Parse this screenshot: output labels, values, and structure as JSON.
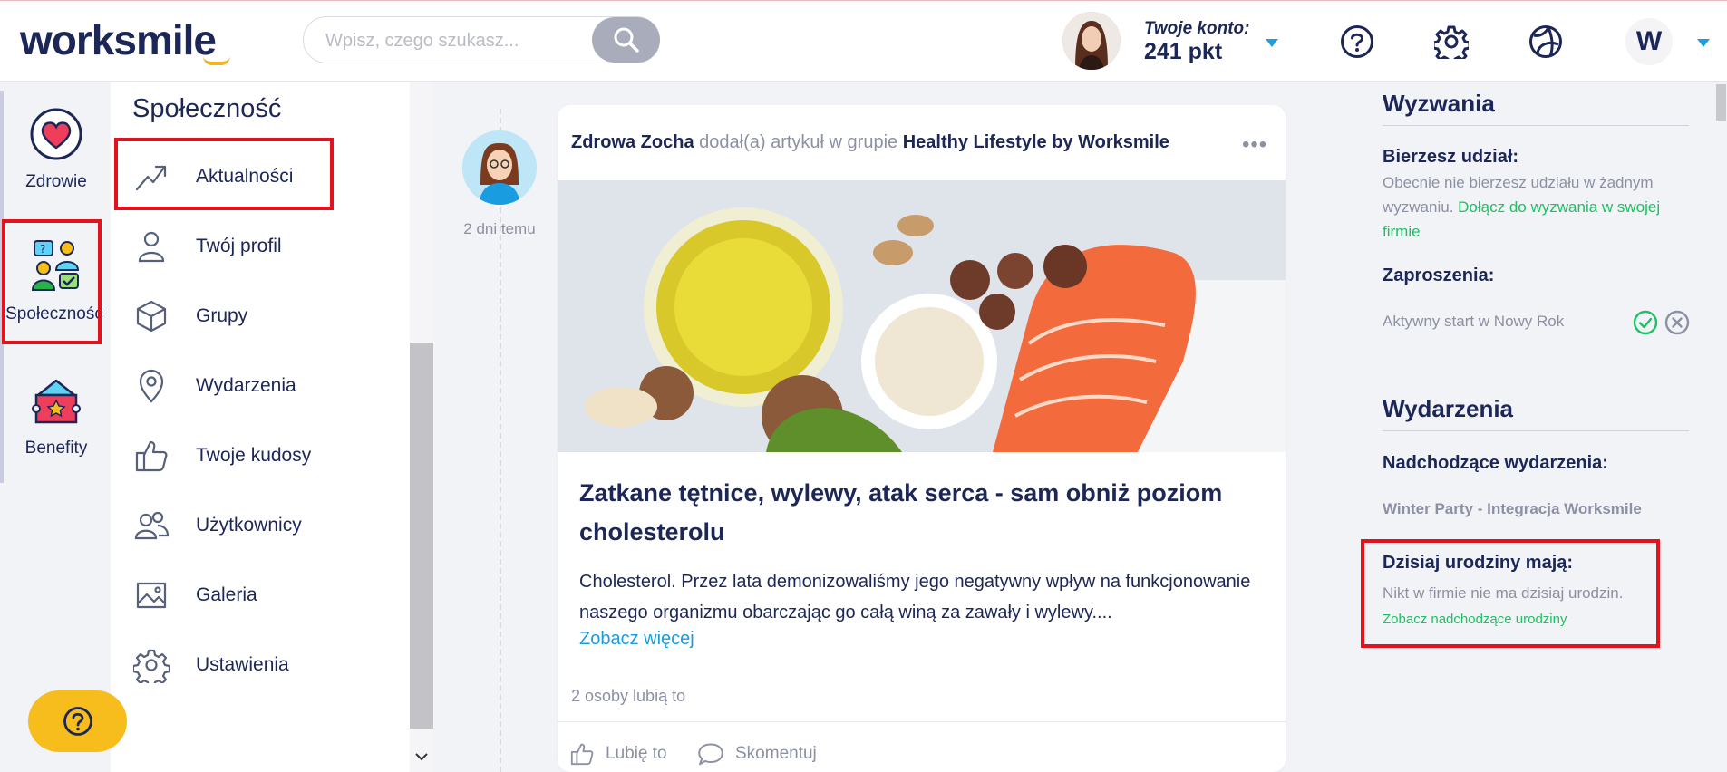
{
  "header": {
    "logo_text": "worksmile",
    "search_placeholder": "Wpisz, czego szukasz...",
    "account_label": "Twoje konto:",
    "account_points": "241 pkt",
    "icons": [
      "search-icon",
      "help-circle-icon",
      "gear-icon",
      "globe-ball-icon"
    ],
    "company_logo_letter": "W"
  },
  "rail": {
    "items": [
      {
        "label": "Zdrowie",
        "icon": "heart-icon"
      },
      {
        "label": "Społeczność",
        "icon": "community-icon",
        "active": true
      },
      {
        "label": "Benefity",
        "icon": "benefits-ticket-icon"
      }
    ]
  },
  "nav": {
    "title": "Społeczność",
    "items": [
      {
        "label": "Aktualności",
        "icon": "trend-arrow-icon",
        "active": true
      },
      {
        "label": "Twój profil",
        "icon": "user-icon"
      },
      {
        "label": "Grupy",
        "icon": "cube-icon"
      },
      {
        "label": "Wydarzenia",
        "icon": "location-pin-icon"
      },
      {
        "label": "Twoje kudosy",
        "icon": "thumbs-up-icon"
      },
      {
        "label": "Użytkownicy",
        "icon": "users-icon"
      },
      {
        "label": "Galeria",
        "icon": "image-icon"
      },
      {
        "label": "Ustawienia",
        "icon": "gear-icon"
      }
    ]
  },
  "help_button": {
    "icon": "question-icon"
  },
  "post": {
    "time_ago": "2 dni temu",
    "author": "Zdrowa Zocha",
    "action_text": "dodał(a) artykuł w grupie",
    "group": "Healthy Lifestyle by Worksmile",
    "title": "Zatkane tętnice, wylewy, atak serca - sam obniż poziom cholesterolu",
    "excerpt": "Cholesterol. Przez lata demonizowaliśmy jego negatywny wpływ na funkcjonowanie naszego organizmu obarczając go całą winą za zawały i wylewy....",
    "read_more": "Zobacz więcej",
    "likes": "2 osoby lubią to",
    "like_label": "Lubię to",
    "comment_label": "Skomentuj"
  },
  "sidebar": {
    "challenges_title": "Wyzwania",
    "participating_label": "Bierzesz udział:",
    "participating_text": "Obecnie nie bierzesz udziału w żadnym wyzwaniu.",
    "join_link": "Dołącz do wyzwania w swojej firmie",
    "invitations_label": "Zaproszenia:",
    "invitation_name": "Aktywny start w Nowy Rok",
    "events_title": "Wydarzenia",
    "upcoming_label": "Nadchodzące wydarzenia:",
    "upcoming_event": "Winter Party - Integracja Worksmile",
    "birthdays_label": "Dzisiaj urodziny mają:",
    "birthdays_text": "Nikt w firmie nie ma dzisiaj urodzin.",
    "birthdays_link": "Zobacz nadchodzące urodziny"
  },
  "colors": {
    "brand_navy": "#1c2757",
    "accent_yellow": "#f6bd1d",
    "link_blue": "#1a9de0",
    "link_green": "#1fbf63",
    "highlight_red": "#e3121c"
  }
}
